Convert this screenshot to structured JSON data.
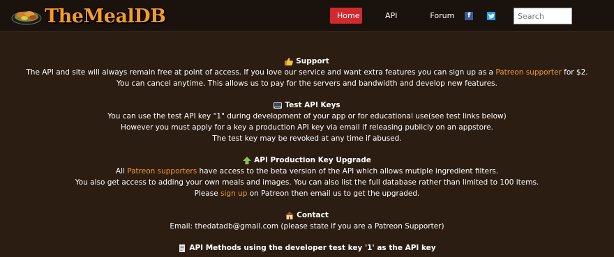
{
  "brand": {
    "name": "TheMealDB"
  },
  "nav": {
    "home": "Home",
    "api": "API",
    "forum": "Forum"
  },
  "search": {
    "placeholder": "Search"
  },
  "sections": {
    "support": {
      "title": "Support",
      "line1_pre": "The API and site will always remain free at point of access. If you love our service and want extra features you can sign up as a ",
      "line1_link": "Patreon supporter",
      "line1_post": " for $2.",
      "line2": "You can cancel anytime. This allows us to pay for the servers and bandwidth and develop new features."
    },
    "test_keys": {
      "title": "Test API Keys",
      "line1": "You can use the test API key \"1\" during development of your app or for educational use(see test links below)",
      "line2": "However you must apply for a key a production API key via email if releasing publicly on an appstore.",
      "line3": "The test key may be revoked at any time if abused."
    },
    "upgrade": {
      "title": "API Production Key Upgrade",
      "line1_pre": "All ",
      "line1_link": "Patreon supporters",
      "line1_post": " have access to the beta version of the API which allows mutiple ingredient filters.",
      "line2": "You also get access to adding your own meals and images. You can also list the full database rather than limited to 100 items.",
      "line3_pre": "Please ",
      "line3_link": "sign up",
      "line3_post": " on Patreon then email us to get the upgraded."
    },
    "contact": {
      "title": "Contact",
      "line1": "Email: thedatadb@gmail.com (please state if you are a Patreon Supporter)"
    },
    "methods": {
      "title": "API Methods using the developer test key '1' as the API key"
    }
  },
  "icons": {
    "support": "thumbs-up-icon",
    "test_keys": "keyboard-icon",
    "upgrade": "up-arrow-icon",
    "contact": "house-icon",
    "methods": "document-icon",
    "facebook": "facebook-icon",
    "twitter": "twitter-icon"
  },
  "colors": {
    "accent": "#f59a2c",
    "home_button": "#d02a2f",
    "background": "#2b1d12",
    "header": "#1a120c"
  }
}
